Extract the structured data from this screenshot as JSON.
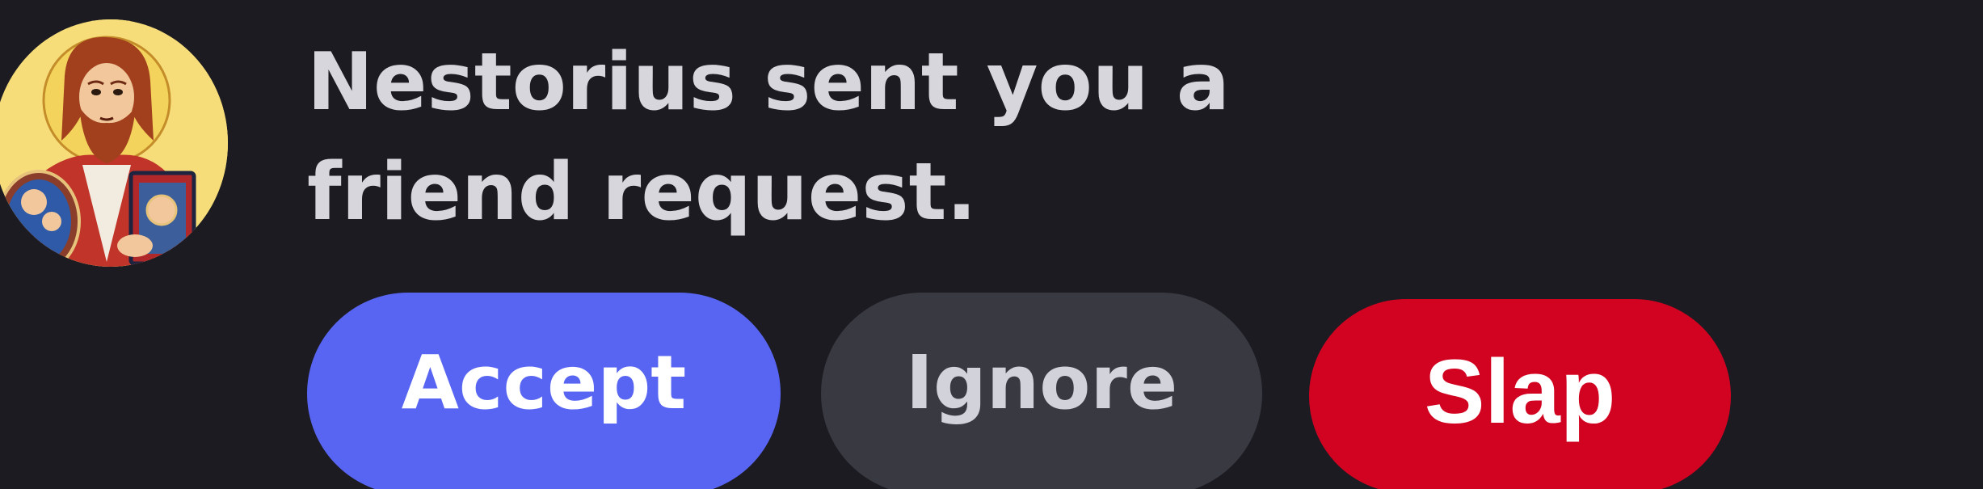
{
  "notification": {
    "avatar_icon": "icon-portrait-avatar",
    "message": "Nestorius sent you a friend request."
  },
  "actions": {
    "accept_label": "Accept",
    "ignore_label": "Ignore",
    "slap_label": "Slap"
  },
  "colors": {
    "background": "#1c1b22",
    "accept": "#5865f2",
    "ignore": "#383941",
    "slap": "#d10321"
  }
}
